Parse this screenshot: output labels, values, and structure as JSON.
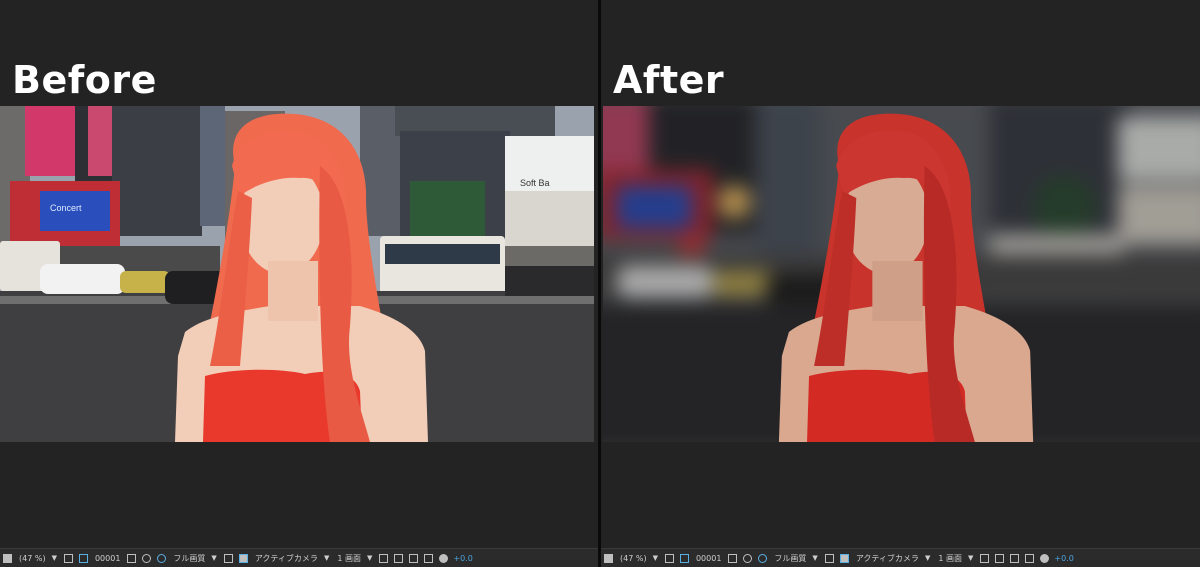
{
  "before": {
    "title": "Before",
    "status": {
      "zoom": "(47 %)",
      "frame": "00001",
      "resolution": "フル画質",
      "camera": "アクティブカメラ",
      "views": "1 画面",
      "exposure": "+0.0"
    }
  },
  "after": {
    "title": "After",
    "status": {
      "zoom": "(47 %)",
      "frame": "00001",
      "resolution": "フル画質",
      "camera": "アクティブカメラ",
      "views": "1 画面",
      "exposure": "+0.0"
    }
  },
  "scene": {
    "billboard_text": "Soft Ba",
    "sign_text": "Concert",
    "colors": {
      "sky": "#9aa3ad",
      "road": "#3f3f41",
      "hair": "#f06a4e",
      "hair_after": "#c8332c",
      "dress": "#e8392c",
      "skin": "#f2cdb8"
    }
  }
}
